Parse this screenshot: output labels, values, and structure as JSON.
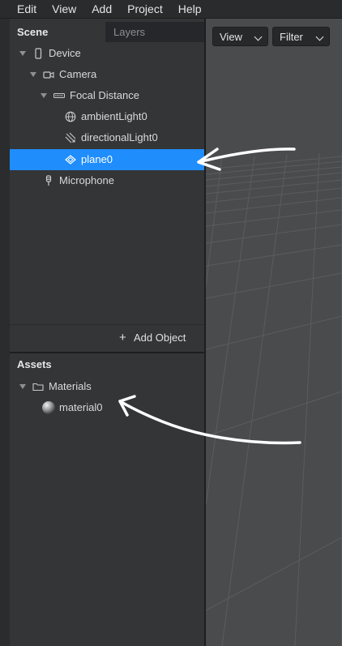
{
  "menu": [
    "Edit",
    "View",
    "Add",
    "Project",
    "Help"
  ],
  "tabs": {
    "scene": "Scene",
    "layers": "Layers"
  },
  "scene_tree": {
    "device": "Device",
    "camera": "Camera",
    "focal_distance": "Focal Distance",
    "ambient_light": "ambientLight0",
    "directional_light": "directionalLight0",
    "plane": "plane0",
    "microphone": "Microphone"
  },
  "add_object_label": "Add Object",
  "assets": {
    "title": "Assets",
    "materials_folder": "Materials",
    "material": "material0"
  },
  "viewport": {
    "view_label": "View",
    "filter_label": "Filter"
  },
  "colors": {
    "selection": "#1f8dfc",
    "panel": "#343537",
    "viewport": "#4a4b4d"
  }
}
